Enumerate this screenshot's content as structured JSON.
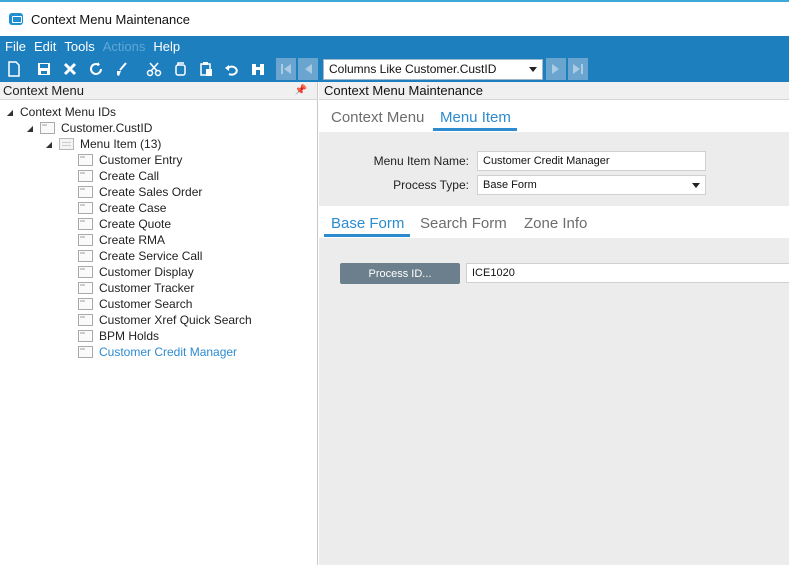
{
  "window": {
    "title": "Context Menu Maintenance"
  },
  "menubar": {
    "items": [
      {
        "label": "File",
        "enabled": true
      },
      {
        "label": "Edit",
        "enabled": true
      },
      {
        "label": "Tools",
        "enabled": true
      },
      {
        "label": "Actions",
        "enabled": false
      },
      {
        "label": "Help",
        "enabled": true
      }
    ]
  },
  "toolbar": {
    "icons": [
      "new-icon",
      "save-icon",
      "delete-icon",
      "refresh-icon",
      "clear-icon",
      "cut-icon",
      "copy-icon",
      "paste-icon",
      "undo-icon",
      "binoculars-icon"
    ],
    "search_value": "Columns Like Customer.CustID"
  },
  "left_panel": {
    "header": "Context Menu",
    "tree": {
      "root": "Context Menu IDs",
      "level1": "Customer.CustID",
      "level2": "Menu Item (13)",
      "items": [
        "Customer Entry",
        "Create Call",
        "Create Sales Order",
        "Create Case",
        "Create Quote",
        "Create RMA",
        "Create Service Call",
        "Customer Display",
        "Customer Tracker",
        "Customer Search",
        "Customer Xref Quick Search",
        "BPM Holds",
        "Customer Credit Manager"
      ],
      "selected_index": 12
    }
  },
  "right_panel": {
    "header": "Context Menu Maintenance",
    "tabs": [
      "Context Menu",
      "Menu Item"
    ],
    "active_tab": 1,
    "form": {
      "menu_item_name_label": "Menu Item Name:",
      "menu_item_name_value": "Customer Credit Manager",
      "process_type_label": "Process Type:",
      "process_type_value": "Base Form"
    },
    "subtabs": [
      "Base Form",
      "Search Form",
      "Zone Info"
    ],
    "active_subtab": 0,
    "process_id_button": "Process ID...",
    "process_id_value": "ICE1020"
  },
  "colors": {
    "accent": "#1e7fbf",
    "tab_active": "#2d8bd0",
    "title_border": "#3ea9d9",
    "button_gray": "#6b7f8c"
  }
}
